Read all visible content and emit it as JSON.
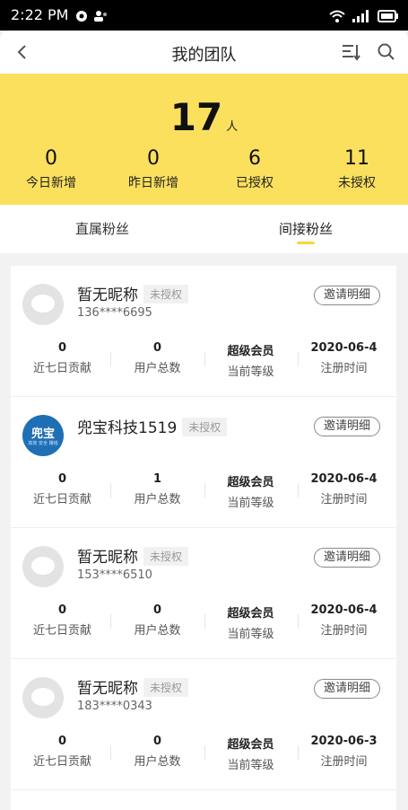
{
  "status_bar": {
    "time": "2:22 PM"
  },
  "header": {
    "title": "我的团队"
  },
  "summary": {
    "total": "17",
    "unit": "人",
    "stats": [
      {
        "value": "0",
        "label": "今日新增"
      },
      {
        "value": "0",
        "label": "昨日新增"
      },
      {
        "value": "6",
        "label": "已授权"
      },
      {
        "value": "11",
        "label": "未授权"
      }
    ]
  },
  "tabs": {
    "direct": "直属粉丝",
    "indirect": "间接粉丝",
    "active": "indirect"
  },
  "colors": {
    "accent": "#fbe05e",
    "tab_indicator": "#fbd43b"
  },
  "members": [
    {
      "name": "暂无昵称",
      "badge": "未授权",
      "phone": "136****6695",
      "invite": "邀请明细",
      "metrics": [
        {
          "value": "0",
          "label": "近七日贡献"
        },
        {
          "value": "0",
          "label": "用户总数"
        },
        {
          "value": "超级会员",
          "label": "当前等级"
        },
        {
          "value": "2020-06-4",
          "label": "注册时间"
        }
      ]
    },
    {
      "name": "兜宝科技1519",
      "badge": "未授权",
      "phone": "",
      "invite": "邀请明细",
      "avatar_text": "兜宝",
      "avatar_sub": "高效 安全 赚钱",
      "metrics": [
        {
          "value": "0",
          "label": "近七日贡献"
        },
        {
          "value": "1",
          "label": "用户总数"
        },
        {
          "value": "超级会员",
          "label": "当前等级"
        },
        {
          "value": "2020-06-4",
          "label": "注册时间"
        }
      ]
    },
    {
      "name": "暂无昵称",
      "badge": "未授权",
      "phone": "153****6510",
      "invite": "邀请明细",
      "metrics": [
        {
          "value": "0",
          "label": "近七日贡献"
        },
        {
          "value": "0",
          "label": "用户总数"
        },
        {
          "value": "超级会员",
          "label": "当前等级"
        },
        {
          "value": "2020-06-4",
          "label": "注册时间"
        }
      ]
    },
    {
      "name": "暂无昵称",
      "badge": "未授权",
      "phone": "183****0343",
      "invite": "邀请明细",
      "metrics": [
        {
          "value": "0",
          "label": "近七日贡献"
        },
        {
          "value": "0",
          "label": "用户总数"
        },
        {
          "value": "超级会员",
          "label": "当前等级"
        },
        {
          "value": "2020-06-3",
          "label": "注册时间"
        }
      ]
    }
  ]
}
